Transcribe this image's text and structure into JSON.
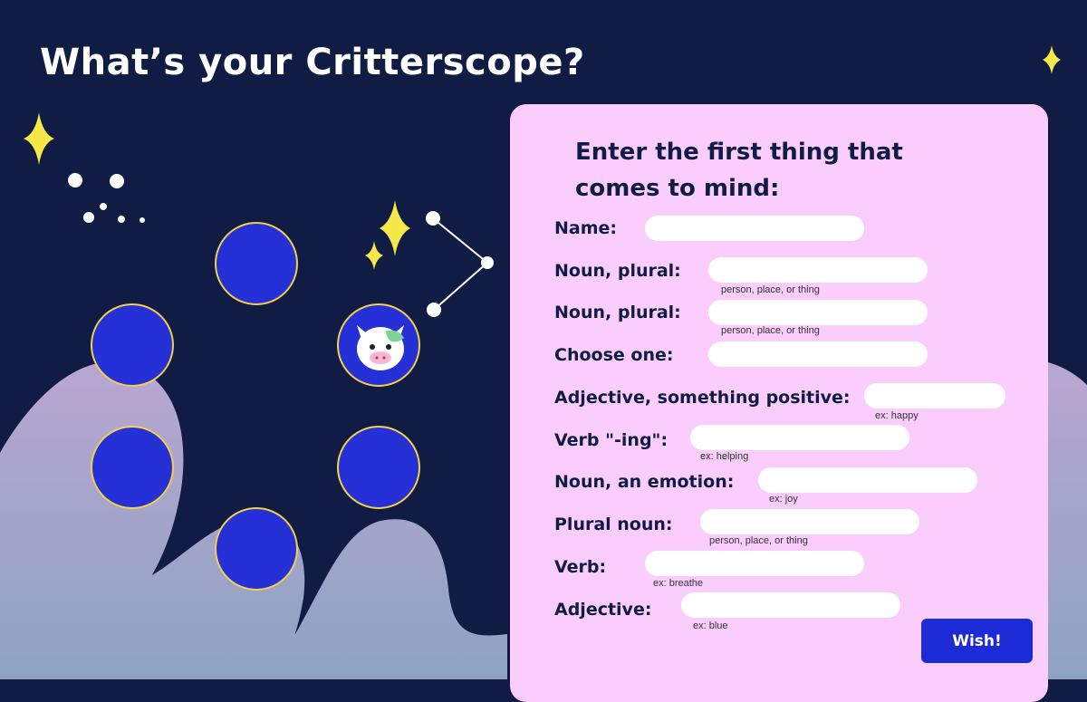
{
  "title": "What’s your Critterscope?",
  "colors": {
    "background": "#101c44",
    "panel": "#facdfd",
    "circle_fill": "#2530d6",
    "circle_border": "#f2d04c",
    "button": "#1c2bd6",
    "sparkle": "#f7e84a"
  },
  "form": {
    "heading": "Enter the first thing that comes to mind:",
    "fields": [
      {
        "label": "Name:",
        "value": "",
        "hint": ""
      },
      {
        "label": "Noun, plural:",
        "value": "",
        "hint": "person, place, or thing"
      },
      {
        "label": "Noun, plural:",
        "value": "",
        "hint": "person, place, or thing"
      },
      {
        "label": "Choose one:",
        "value": "",
        "hint": ""
      },
      {
        "label": "Adjective, something positive:",
        "value": "",
        "hint": "ex: happy"
      },
      {
        "label": "Verb \"-ing\":",
        "value": "",
        "hint": "ex: helping"
      },
      {
        "label": "Noun, an emotion:",
        "value": "",
        "hint": "ex: joy"
      },
      {
        "label": "Plural noun:",
        "value": "",
        "hint": "person, place, or thing"
      },
      {
        "label": "Verb:",
        "value": "",
        "hint": "ex: breathe"
      },
      {
        "label": "Adjective:",
        "value": "",
        "hint": "ex: blue"
      }
    ],
    "submit_label": "Wish!"
  },
  "zodiac_circles": [
    {
      "icon": "none"
    },
    {
      "icon": "cow-icon"
    },
    {
      "icon": "none"
    },
    {
      "icon": "none"
    },
    {
      "icon": "none"
    },
    {
      "icon": "none"
    }
  ]
}
